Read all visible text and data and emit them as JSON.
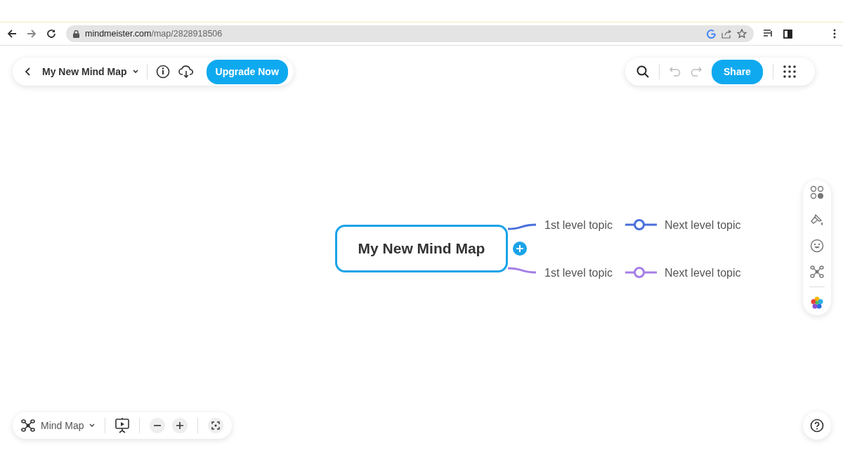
{
  "browser": {
    "url_host": "mindmeister.com",
    "url_path": "/map/2828918506"
  },
  "top_bar": {
    "map_title": "My New Mind Map",
    "upgrade_button": "Upgrade Now"
  },
  "top_right_bar": {
    "share_button": "Share",
    "undo_disabled": true,
    "redo_disabled": true
  },
  "map": {
    "root": "My New Mind Map",
    "topics": [
      {
        "label": "1st level topic",
        "color": "#4a6fdc",
        "children": [
          {
            "label": "Next level topic"
          }
        ]
      },
      {
        "label": "1st level topic",
        "color": "#a57ee6",
        "children": [
          {
            "label": "Next level topic"
          }
        ]
      }
    ]
  },
  "bottom_bar": {
    "view_mode": "Mind Map"
  }
}
